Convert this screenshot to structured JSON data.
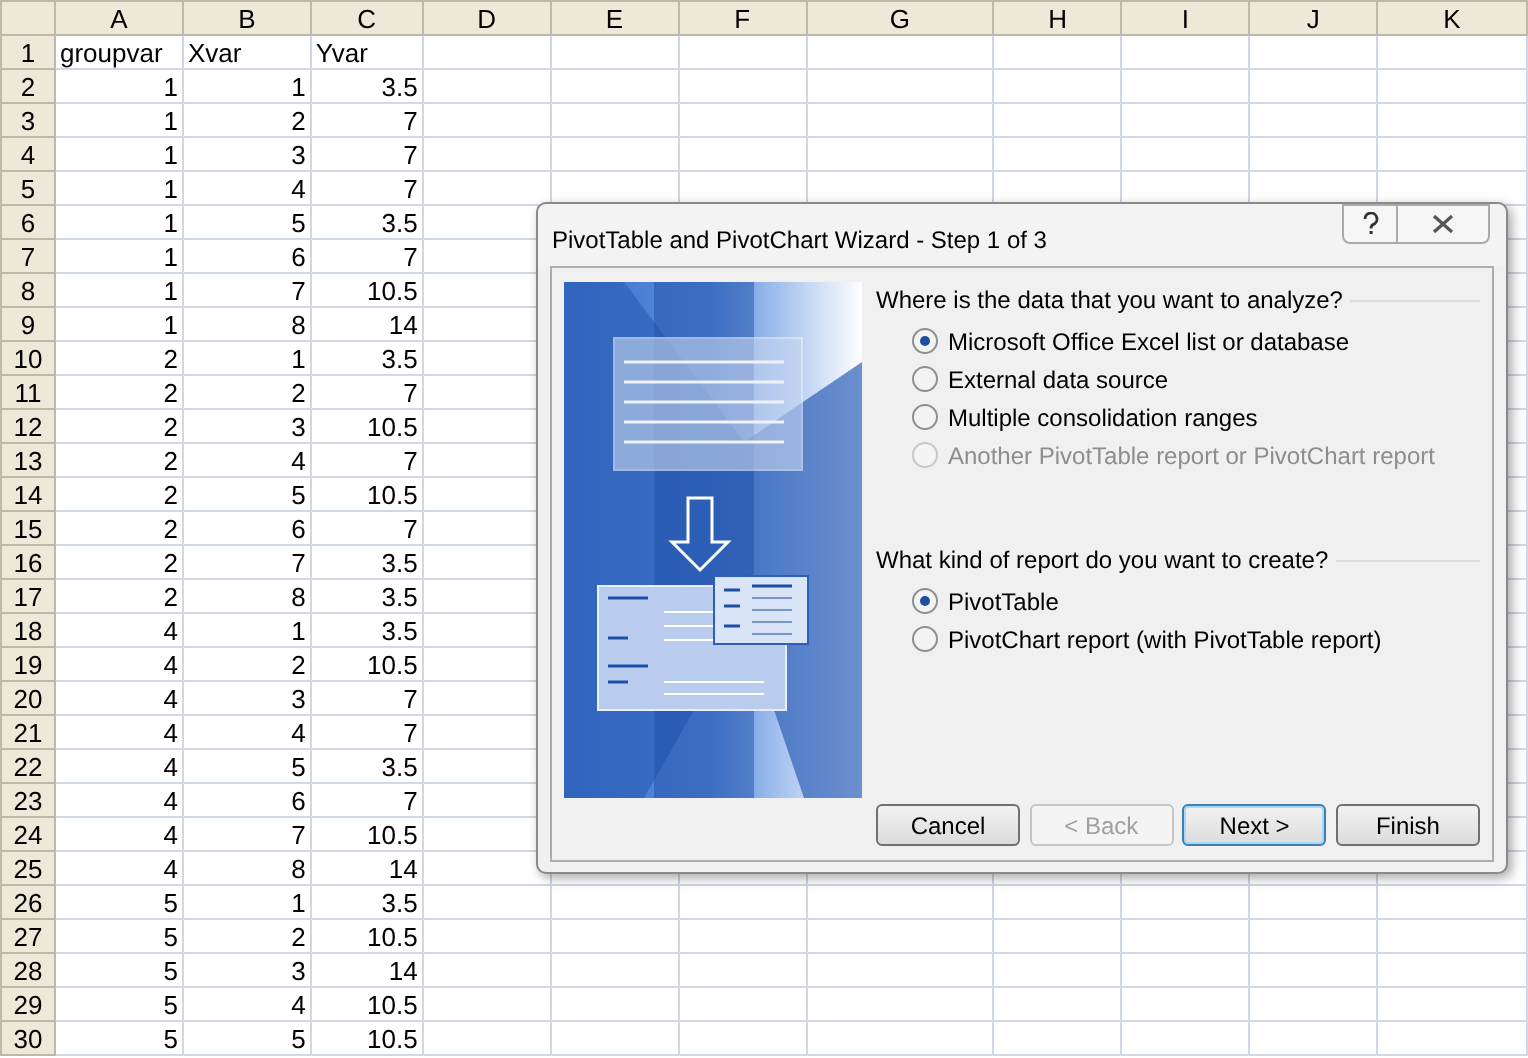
{
  "sheet": {
    "columns": [
      "A",
      "B",
      "C",
      "D",
      "E",
      "F",
      "G",
      "H",
      "I",
      "J",
      "K"
    ],
    "rows": [
      {
        "number": "1",
        "kind": "text",
        "cells": [
          "groupvar",
          "Xvar",
          "Yvar"
        ]
      },
      {
        "number": "2",
        "kind": "number",
        "cells": [
          "1",
          "1",
          "3.5"
        ]
      },
      {
        "number": "3",
        "kind": "number",
        "cells": [
          "1",
          "2",
          "7"
        ]
      },
      {
        "number": "4",
        "kind": "number",
        "cells": [
          "1",
          "3",
          "7"
        ]
      },
      {
        "number": "5",
        "kind": "number",
        "cells": [
          "1",
          "4",
          "7"
        ]
      },
      {
        "number": "6",
        "kind": "number",
        "cells": [
          "1",
          "5",
          "3.5"
        ]
      },
      {
        "number": "7",
        "kind": "number",
        "cells": [
          "1",
          "6",
          "7"
        ]
      },
      {
        "number": "8",
        "kind": "number",
        "cells": [
          "1",
          "7",
          "10.5"
        ]
      },
      {
        "number": "9",
        "kind": "number",
        "cells": [
          "1",
          "8",
          "14"
        ]
      },
      {
        "number": "10",
        "kind": "number",
        "cells": [
          "2",
          "1",
          "3.5"
        ]
      },
      {
        "number": "11",
        "kind": "number",
        "cells": [
          "2",
          "2",
          "7"
        ]
      },
      {
        "number": "12",
        "kind": "number",
        "cells": [
          "2",
          "3",
          "10.5"
        ]
      },
      {
        "number": "13",
        "kind": "number",
        "cells": [
          "2",
          "4",
          "7"
        ]
      },
      {
        "number": "14",
        "kind": "number",
        "cells": [
          "2",
          "5",
          "10.5"
        ]
      },
      {
        "number": "15",
        "kind": "number",
        "cells": [
          "2",
          "6",
          "7"
        ]
      },
      {
        "number": "16",
        "kind": "number",
        "cells": [
          "2",
          "7",
          "3.5"
        ]
      },
      {
        "number": "17",
        "kind": "number",
        "cells": [
          "2",
          "8",
          "3.5"
        ]
      },
      {
        "number": "18",
        "kind": "number",
        "cells": [
          "4",
          "1",
          "3.5"
        ]
      },
      {
        "number": "19",
        "kind": "number",
        "cells": [
          "4",
          "2",
          "10.5"
        ]
      },
      {
        "number": "20",
        "kind": "number",
        "cells": [
          "4",
          "3",
          "7"
        ]
      },
      {
        "number": "21",
        "kind": "number",
        "cells": [
          "4",
          "4",
          "7"
        ]
      },
      {
        "number": "22",
        "kind": "number",
        "cells": [
          "4",
          "5",
          "3.5"
        ]
      },
      {
        "number": "23",
        "kind": "number",
        "cells": [
          "4",
          "6",
          "7"
        ]
      },
      {
        "number": "24",
        "kind": "number",
        "cells": [
          "4",
          "7",
          "10.5"
        ]
      },
      {
        "number": "25",
        "kind": "number",
        "cells": [
          "4",
          "8",
          "14"
        ]
      },
      {
        "number": "26",
        "kind": "number",
        "cells": [
          "5",
          "1",
          "3.5"
        ]
      },
      {
        "number": "27",
        "kind": "number",
        "cells": [
          "5",
          "2",
          "10.5"
        ]
      },
      {
        "number": "28",
        "kind": "number",
        "cells": [
          "5",
          "3",
          "14"
        ]
      },
      {
        "number": "29",
        "kind": "number",
        "cells": [
          "5",
          "4",
          "10.5"
        ]
      },
      {
        "number": "30",
        "kind": "number",
        "cells": [
          "5",
          "5",
          "10.5"
        ]
      }
    ]
  },
  "dialog": {
    "title": "PivotTable and PivotChart Wizard - Step 1 of 3",
    "sections": [
      {
        "question": "Where is the data that you want to analyze?",
        "options": [
          {
            "label": "Microsoft Office Excel list or database",
            "selected": true,
            "disabled": false
          },
          {
            "label": "External data source",
            "selected": false,
            "disabled": false
          },
          {
            "label": "Multiple consolidation ranges",
            "selected": false,
            "disabled": false
          },
          {
            "label": "Another PivotTable report or PivotChart report",
            "selected": false,
            "disabled": true
          }
        ]
      },
      {
        "question": "What kind of report do you want to create?",
        "options": [
          {
            "label": "PivotTable",
            "selected": true,
            "disabled": false
          },
          {
            "label": "PivotChart report (with PivotTable report)",
            "selected": false,
            "disabled": false
          }
        ]
      }
    ],
    "buttons": [
      {
        "label": "Cancel",
        "disabled": false,
        "default": false
      },
      {
        "label": "< Back",
        "disabled": true,
        "default": false
      },
      {
        "label": "Next >",
        "disabled": false,
        "default": true
      },
      {
        "label": "Finish",
        "disabled": false,
        "default": false
      }
    ]
  }
}
